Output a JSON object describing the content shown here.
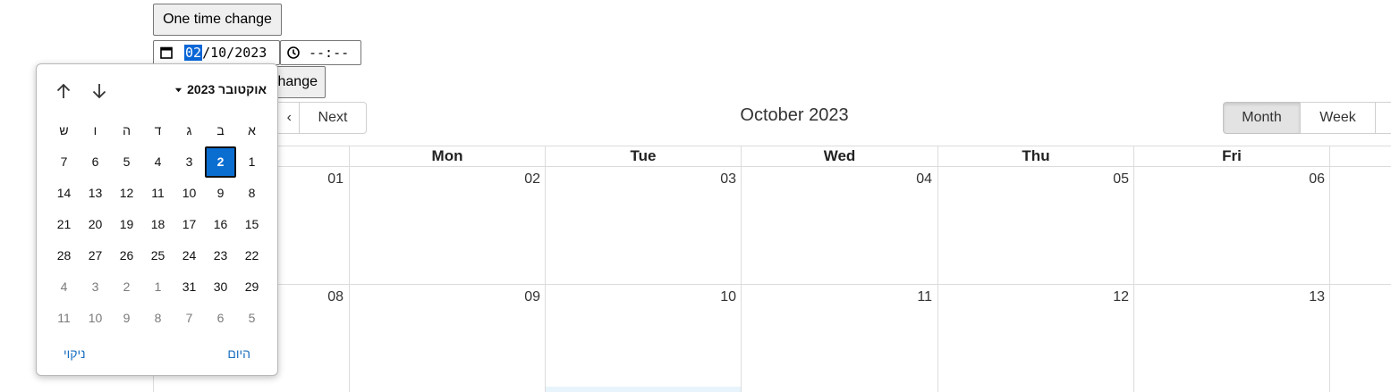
{
  "controls": {
    "one_time_label": "One time change",
    "second_button_label": "hange",
    "date_input": {
      "day": "02",
      "month": "10",
      "year": "2023",
      "sep": "/"
    },
    "time_input": {
      "value": "--:--"
    }
  },
  "calendar": {
    "title": "October 2023",
    "prev_label": "‹",
    "next_label": "Next",
    "view_buttons": [
      {
        "label": "Month",
        "active": true
      },
      {
        "label": "Week",
        "active": false
      }
    ],
    "day_headers": [
      "Mon",
      "Tue",
      "Wed",
      "Thu",
      "Fri"
    ],
    "weeks": [
      [
        "01",
        "02",
        "03",
        "04",
        "05",
        "06"
      ],
      [
        "08",
        "09",
        "10",
        "11",
        "12",
        "13"
      ]
    ]
  },
  "datepicker": {
    "month_label": "אוקטובר 2023",
    "weekdays": [
      "א",
      "ב",
      "ג",
      "ד",
      "ה",
      "ו",
      "ש"
    ],
    "selected_day": "2",
    "rows": [
      [
        {
          "d": "1",
          "out": false
        },
        {
          "d": "2",
          "out": false,
          "sel": true
        },
        {
          "d": "3",
          "out": false
        },
        {
          "d": "4",
          "out": false
        },
        {
          "d": "5",
          "out": false
        },
        {
          "d": "6",
          "out": false
        },
        {
          "d": "7",
          "out": false
        }
      ],
      [
        {
          "d": "8",
          "out": false
        },
        {
          "d": "9",
          "out": false
        },
        {
          "d": "10",
          "out": false
        },
        {
          "d": "11",
          "out": false
        },
        {
          "d": "12",
          "out": false
        },
        {
          "d": "13",
          "out": false
        },
        {
          "d": "14",
          "out": false
        }
      ],
      [
        {
          "d": "15",
          "out": false
        },
        {
          "d": "16",
          "out": false
        },
        {
          "d": "17",
          "out": false
        },
        {
          "d": "18",
          "out": false
        },
        {
          "d": "19",
          "out": false
        },
        {
          "d": "20",
          "out": false
        },
        {
          "d": "21",
          "out": false
        }
      ],
      [
        {
          "d": "22",
          "out": false
        },
        {
          "d": "23",
          "out": false
        },
        {
          "d": "24",
          "out": false
        },
        {
          "d": "25",
          "out": false
        },
        {
          "d": "26",
          "out": false
        },
        {
          "d": "27",
          "out": false
        },
        {
          "d": "28",
          "out": false
        }
      ],
      [
        {
          "d": "29",
          "out": false
        },
        {
          "d": "30",
          "out": false
        },
        {
          "d": "31",
          "out": false
        },
        {
          "d": "1",
          "out": true
        },
        {
          "d": "2",
          "out": true
        },
        {
          "d": "3",
          "out": true
        },
        {
          "d": "4",
          "out": true
        }
      ],
      [
        {
          "d": "5",
          "out": true
        },
        {
          "d": "6",
          "out": true
        },
        {
          "d": "7",
          "out": true
        },
        {
          "d": "8",
          "out": true
        },
        {
          "d": "9",
          "out": true
        },
        {
          "d": "10",
          "out": true
        },
        {
          "d": "11",
          "out": true
        }
      ]
    ],
    "today_label": "היום",
    "clear_label": "ניקוי",
    "icons": {
      "up": "arrow-up-icon",
      "down": "arrow-down-icon",
      "dropdown": "triangle-down-icon"
    }
  },
  "colors": {
    "accent": "#0a6ed1",
    "link": "#1a6fc1",
    "grid_line": "#dcdcdc",
    "today_highlight": "#e8f4fb"
  }
}
